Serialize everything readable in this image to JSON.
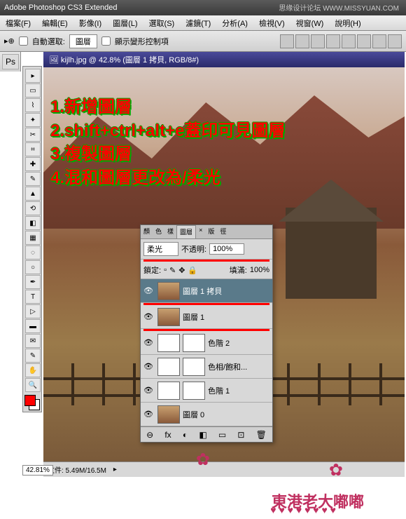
{
  "titlebar": "Adobe Photoshop CS3 Extended",
  "topright": "思缘设计论坛 WWW.MISSYUAN.COM",
  "menu": [
    "檔案(F)",
    "編輯(E)",
    "影像(I)",
    "圖層(L)",
    "選取(S)",
    "濾鏡(T)",
    "分析(A)",
    "檢視(V)",
    "視窗(W)",
    "說明(H)"
  ],
  "optbar": {
    "autoselect": "自動選取:",
    "layer": "圖層",
    "showtransform": "顯示變形控制項"
  },
  "doctab": "kijlh.jpg @ 42.8% (圖層 1 拷貝, RGB/8#)",
  "annotations": [
    "1.新增圖層",
    "2.shift+ctrl+alt+e蓋印可見圖層",
    "3.複製圖層",
    "4.混和圖層更改為/柔光"
  ],
  "zoom": "42.81%",
  "status_file": "文件: 5.49M/16.5M",
  "layers_panel": {
    "tabs": [
      "顏",
      "色",
      "樣",
      "圖層",
      "×",
      "版",
      "徑"
    ],
    "blend": "柔光",
    "opacity_label": "不透明:",
    "opacity": "100%",
    "lock_label": "鎖定:",
    "fill_label": "填滿:",
    "fill": "100%",
    "rows": [
      {
        "name": "圖層 1 拷貝",
        "type": "img",
        "sel": true
      },
      {
        "name": "圖層 1",
        "type": "img"
      },
      {
        "name": "色階 2",
        "type": "adj",
        "mask": true
      },
      {
        "name": "色相/飽和...",
        "type": "adj",
        "mask": true
      },
      {
        "name": "色階 1",
        "type": "adj",
        "mask": true
      },
      {
        "name": "圖層 0",
        "type": "img"
      }
    ],
    "foot_icons": [
      "⊖",
      "fx",
      "◐",
      "◧",
      "▭",
      "⊡",
      "🗑"
    ]
  },
  "watermark": "東港老大嘟嘟"
}
